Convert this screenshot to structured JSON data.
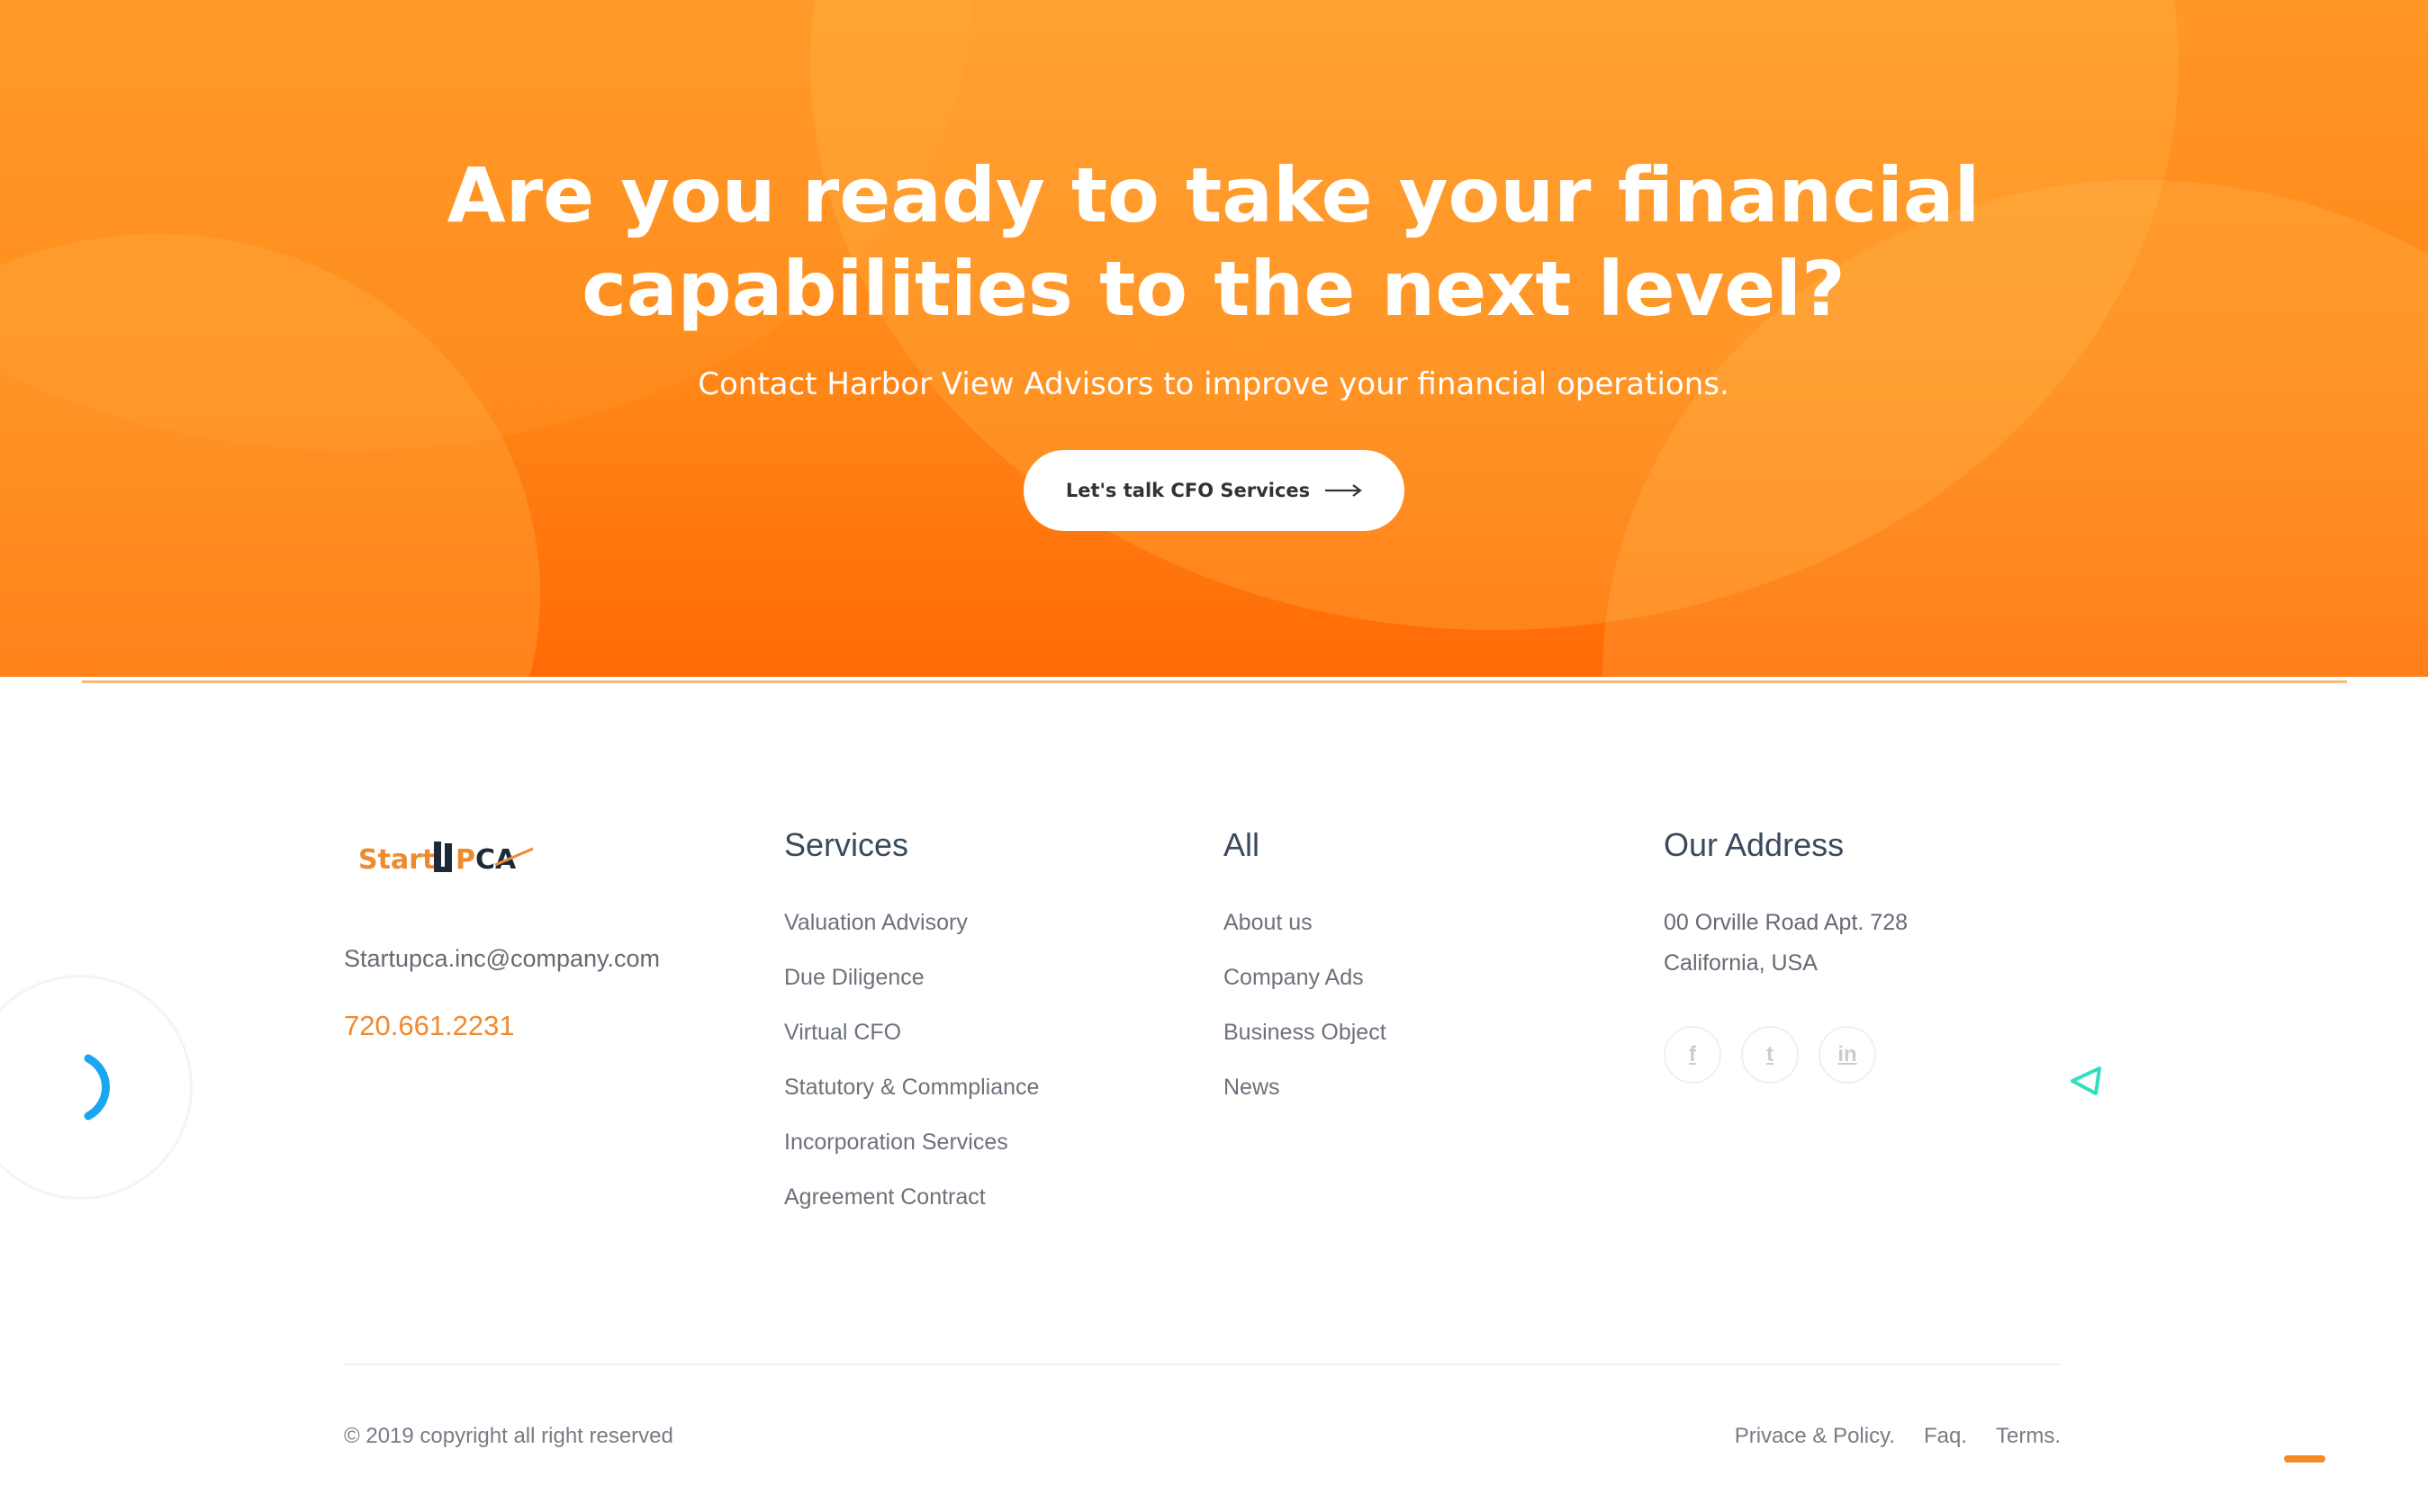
{
  "cta": {
    "title": "Are you ready to take your financial capabilities to the next level?",
    "subtitle": "Contact Harbor View Advisors to improve your financial operations.",
    "button_label": "Let's talk CFO Services",
    "button_icon": "arrow-right-icon",
    "colors": {
      "gradient_top": "#ff9726",
      "gradient_bottom": "#ff6a05",
      "button_bg": "#ffffff"
    }
  },
  "footer": {
    "logo_text": "StartUpCA",
    "email": "Startupca.inc@company.com",
    "phone": "720.661.2231",
    "services": {
      "title": "Services",
      "items": [
        "Valuation Advisory",
        "Due Diligence",
        "Virtual CFO",
        "Statutory & Commpliance",
        "Incorporation Services",
        "Agreement Contract"
      ]
    },
    "all": {
      "title": "All",
      "items": [
        "About us",
        "Company Ads",
        "Business Object",
        "News"
      ]
    },
    "address": {
      "title": "Our Address",
      "line1": "00 Orville Road Apt. 728",
      "line2": "California, USA"
    },
    "socials": [
      {
        "name": "facebook-icon",
        "glyph": "f"
      },
      {
        "name": "twitter-icon",
        "glyph": "t"
      },
      {
        "name": "linkedin-icon",
        "glyph": "in"
      }
    ],
    "copyright": "© 2019 copyright all right reserved",
    "legal_links": [
      "Privace & Policy.",
      "Faq.",
      "Terms."
    ],
    "colors": {
      "accent": "#f08a2e",
      "heading": "#3a4a5c",
      "text": "#6d717b"
    }
  }
}
